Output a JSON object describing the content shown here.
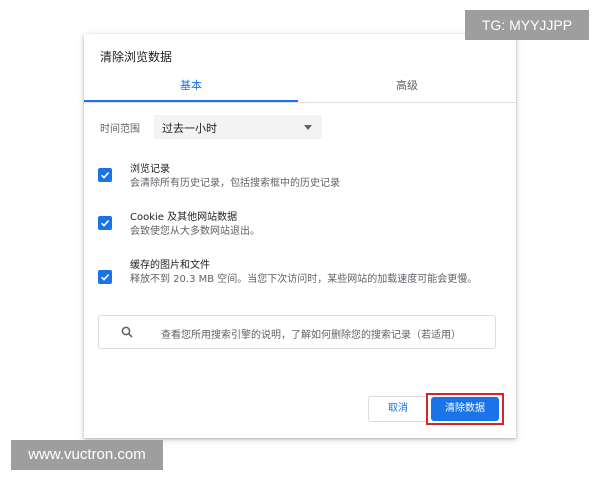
{
  "dialog": {
    "title": "清除浏览数据",
    "tabs": [
      {
        "label": "基本",
        "active": true
      },
      {
        "label": "高级",
        "active": false
      }
    ],
    "time_range": {
      "label": "时间范围",
      "selected": "过去一小时"
    },
    "options": [
      {
        "title": "浏览记录",
        "description": "会清除所有历史记录，包括搜索框中的历史记录",
        "checked": true
      },
      {
        "title": "Cookie 及其他网站数据",
        "description": "会致使您从大多数网站退出。",
        "checked": true
      },
      {
        "title": "缓存的图片和文件",
        "description": "释放不到 20.3 MB 空间。当您下次访问时，某些网站的加载速度可能会更慢。",
        "checked": true
      }
    ],
    "search_note": "查看您所用搜索引擎的说明，了解如何删除您的搜索记录（若适用）",
    "buttons": {
      "cancel": "取消",
      "clear": "清除数据"
    }
  },
  "watermarks": {
    "telegram": "TG: MYYJJPP",
    "site": "www.vuctron.com"
  },
  "colors": {
    "accent": "#1a73e8",
    "highlight_outline": "#d8232a",
    "watermark_bg": "#9e9e9e"
  }
}
